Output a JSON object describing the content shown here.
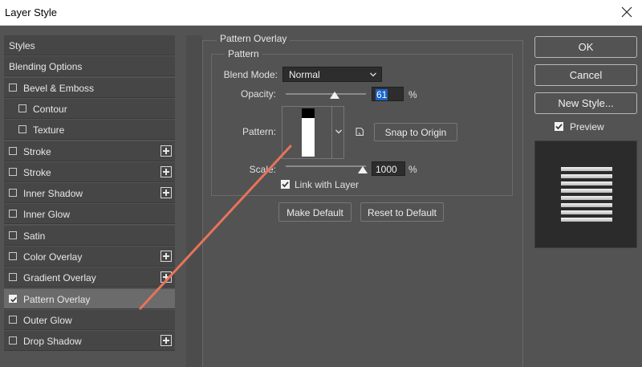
{
  "window": {
    "title": "Layer Style"
  },
  "styles_list": [
    {
      "label": "Styles",
      "checkbox": false,
      "indent": 0,
      "plus": false,
      "selected": false
    },
    {
      "label": "Blending Options",
      "checkbox": false,
      "indent": 0,
      "plus": false,
      "selected": false
    },
    {
      "label": "Bevel & Emboss",
      "checkbox": true,
      "checked": false,
      "indent": 0,
      "plus": false,
      "selected": false
    },
    {
      "label": "Contour",
      "checkbox": true,
      "checked": false,
      "indent": 1,
      "plus": false,
      "selected": false
    },
    {
      "label": "Texture",
      "checkbox": true,
      "checked": false,
      "indent": 1,
      "plus": false,
      "selected": false
    },
    {
      "label": "Stroke",
      "checkbox": true,
      "checked": false,
      "indent": 0,
      "plus": true,
      "selected": false
    },
    {
      "label": "Stroke",
      "checkbox": true,
      "checked": false,
      "indent": 0,
      "plus": true,
      "selected": false
    },
    {
      "label": "Inner Shadow",
      "checkbox": true,
      "checked": false,
      "indent": 0,
      "plus": true,
      "selected": false
    },
    {
      "label": "Inner Glow",
      "checkbox": true,
      "checked": false,
      "indent": 0,
      "plus": false,
      "selected": false
    },
    {
      "label": "Satin",
      "checkbox": true,
      "checked": false,
      "indent": 0,
      "plus": false,
      "selected": false
    },
    {
      "label": "Color Overlay",
      "checkbox": true,
      "checked": false,
      "indent": 0,
      "plus": true,
      "selected": false
    },
    {
      "label": "Gradient Overlay",
      "checkbox": true,
      "checked": false,
      "indent": 0,
      "plus": true,
      "selected": false
    },
    {
      "label": "Pattern Overlay",
      "checkbox": true,
      "checked": true,
      "indent": 0,
      "plus": false,
      "selected": true
    },
    {
      "label": "Outer Glow",
      "checkbox": true,
      "checked": false,
      "indent": 0,
      "plus": false,
      "selected": false
    },
    {
      "label": "Drop Shadow",
      "checkbox": true,
      "checked": false,
      "indent": 0,
      "plus": true,
      "selected": false
    }
  ],
  "panel": {
    "group_title": "Pattern Overlay",
    "subgroup_title": "Pattern",
    "blend_mode_label": "Blend Mode:",
    "blend_mode_value": "Normal",
    "opacity_label": "Opacity:",
    "opacity_value": "61",
    "opacity_unit": "%",
    "opacity_level": 61,
    "pattern_label": "Pattern:",
    "snap_button": "Snap to Origin",
    "scale_label": "Scale:",
    "scale_value": "1000",
    "scale_unit": "%",
    "link_label": "Link with Layer",
    "link_checked": true,
    "make_default": "Make Default",
    "reset_default": "Reset to Default"
  },
  "actions": {
    "ok": "OK",
    "cancel": "Cancel",
    "new_style": "New Style...",
    "preview_label": "Preview",
    "preview_checked": true
  },
  "colors": {
    "dialog_bg": "#535353",
    "list_row_bg": "#464646",
    "selected_row_bg": "#6b6b6b",
    "field_bg": "#2d2d2d",
    "selection_blue": "#1a63c9",
    "annotation_arrow": "#e8735a"
  },
  "icons": [
    "close-icon",
    "checkbox-icon",
    "add-icon",
    "chevron-down-icon",
    "new-preset-icon",
    "slider-thumb-icon"
  ]
}
